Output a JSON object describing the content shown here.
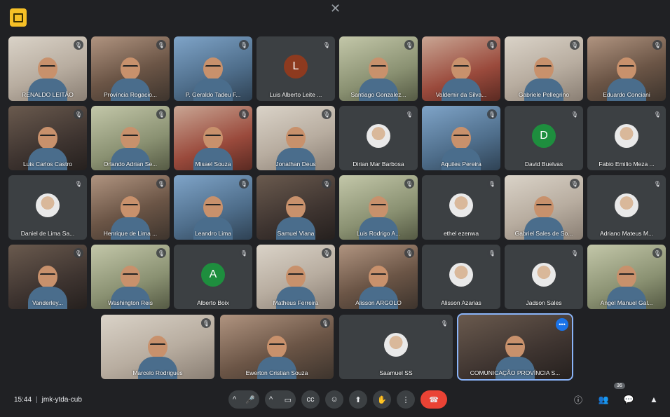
{
  "close_glyph": "✕",
  "meeting": {
    "time": "15:44",
    "separator": "|",
    "code": "jmk-ytda-cub"
  },
  "participants_count": "36",
  "rows": [
    [
      {
        "name": "RENALDO LEITÃO",
        "type": "cam"
      },
      {
        "name": "Província Rogacio...",
        "type": "cam"
      },
      {
        "name": "P. Geraldo Tadeu F...",
        "type": "cam"
      },
      {
        "name": "Luis Alberto Leite ...",
        "type": "avatar",
        "letter": "L",
        "color": "#8d3a1f"
      },
      {
        "name": "Santiago Gonzalez...",
        "type": "cam"
      },
      {
        "name": "Valdemir da Silva...",
        "type": "cam"
      },
      {
        "name": "Gabriele Pellegrino",
        "type": "cam"
      },
      {
        "name": "Eduardo Conciani",
        "type": "cam"
      }
    ],
    [
      {
        "name": "Luis Carlos Castro",
        "type": "cam"
      },
      {
        "name": "Orlando Adrian Se...",
        "type": "cam"
      },
      {
        "name": "Misael Souza",
        "type": "cam"
      },
      {
        "name": "Jonathan Deus",
        "type": "cam"
      },
      {
        "name": "Dirian Mar Barbosa",
        "type": "photo"
      },
      {
        "name": "Aquiles Pereira",
        "type": "cam"
      },
      {
        "name": "David Buelvas",
        "type": "avatar",
        "letter": "D",
        "color": "#1e8e3e"
      },
      {
        "name": "Fabio Emilio Meza ...",
        "type": "photo"
      }
    ],
    [
      {
        "name": "Daniel de Lima Sa...",
        "type": "photo"
      },
      {
        "name": "Henrique de Lima ...",
        "type": "cam"
      },
      {
        "name": "Leandro Lima",
        "type": "cam"
      },
      {
        "name": "Samuel Viana",
        "type": "cam"
      },
      {
        "name": "Luis Rodrigo A...",
        "type": "cam"
      },
      {
        "name": "ethel ezenwa",
        "type": "photo"
      },
      {
        "name": "Gabriel Sales de So...",
        "type": "cam"
      },
      {
        "name": "Adriano Mateus M...",
        "type": "photo"
      }
    ],
    [
      {
        "name": "Vanderley...",
        "type": "cam"
      },
      {
        "name": "Washington Reis",
        "type": "cam"
      },
      {
        "name": "Alberto Boix",
        "type": "avatar",
        "letter": "A",
        "color": "#1e8e3e"
      },
      {
        "name": "Matheus Ferreira",
        "type": "cam"
      },
      {
        "name": "Alisson ARGOLO",
        "type": "cam"
      },
      {
        "name": "Alisson Azarias",
        "type": "photo"
      },
      {
        "name": "Jadson Sales",
        "type": "photo"
      },
      {
        "name": "Angel Manuel Gal...",
        "type": "cam"
      }
    ],
    [
      {
        "name": "Marcelo Rodrigues",
        "type": "cam"
      },
      {
        "name": "Ewerton Cristian Souza",
        "type": "cam"
      },
      {
        "name": "Saamuel SS",
        "type": "photo"
      },
      {
        "name": "COMUNICAÇÃO PROVÍNCIA S...",
        "type": "cam"
      }
    ]
  ],
  "icons": {
    "mute": "🎙",
    "more": "•••",
    "mic": "🎤",
    "camera": "▭",
    "captions": "cc",
    "emoji": "☺",
    "present": "⬆",
    "hand": "✋",
    "options": "⋮",
    "end_call": "☎",
    "info": "ⓘ",
    "people": "👥",
    "chat": "💬",
    "activities": "▲"
  }
}
